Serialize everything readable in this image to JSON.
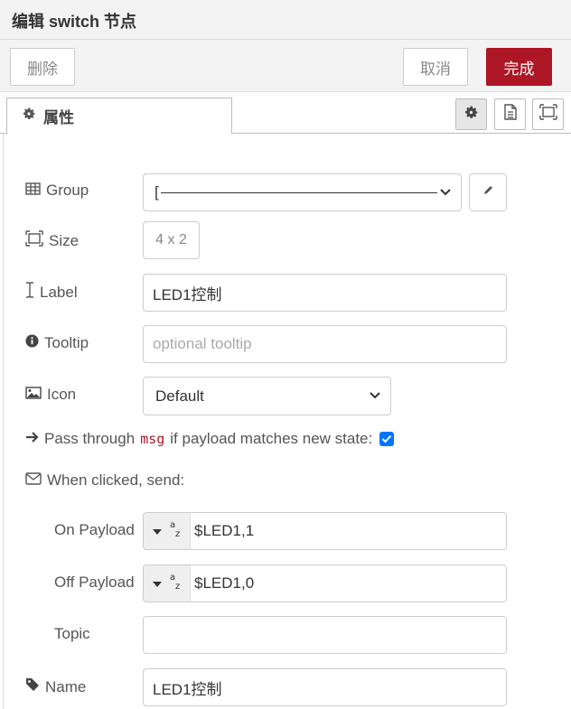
{
  "header": {
    "title": "编辑 switch 节点"
  },
  "buttons": {
    "delete": "删除",
    "cancel": "取消",
    "done": "完成"
  },
  "tab": {
    "label": "属性"
  },
  "form": {
    "group": {
      "label": "Group",
      "value": "["
    },
    "size": {
      "label": "Size",
      "value": "4 x 2"
    },
    "label": {
      "label": "Label",
      "value": "LED1控制"
    },
    "tooltip": {
      "label": "Tooltip",
      "placeholder": "optional tooltip"
    },
    "icon": {
      "label": "Icon",
      "value": "Default"
    },
    "pass": {
      "prefix": "Pass through",
      "code": "msg",
      "suffix": "if payload matches new state:",
      "checked": true
    },
    "when_clicked": {
      "label": "When clicked, send:"
    },
    "on_payload": {
      "label": "On Payload",
      "value": "$LED1,1"
    },
    "off_payload": {
      "label": "Off Payload",
      "value": "$LED1,0"
    },
    "topic": {
      "label": "Topic",
      "value": ""
    },
    "name": {
      "label": "Name",
      "value": "LED1控制"
    }
  },
  "icons": [
    "gear-icon",
    "document-icon",
    "frame-icon",
    "table-icon",
    "resize-icon",
    "text-cursor-icon",
    "info-icon",
    "image-icon",
    "arrow-right-icon",
    "envelope-icon",
    "tag-icon",
    "pencil-icon",
    "chevron-down-icon",
    "caret-down-icon",
    "string-type-icon"
  ],
  "colors": {
    "accent": "#ad1625",
    "checkbox": "#0075ff"
  }
}
